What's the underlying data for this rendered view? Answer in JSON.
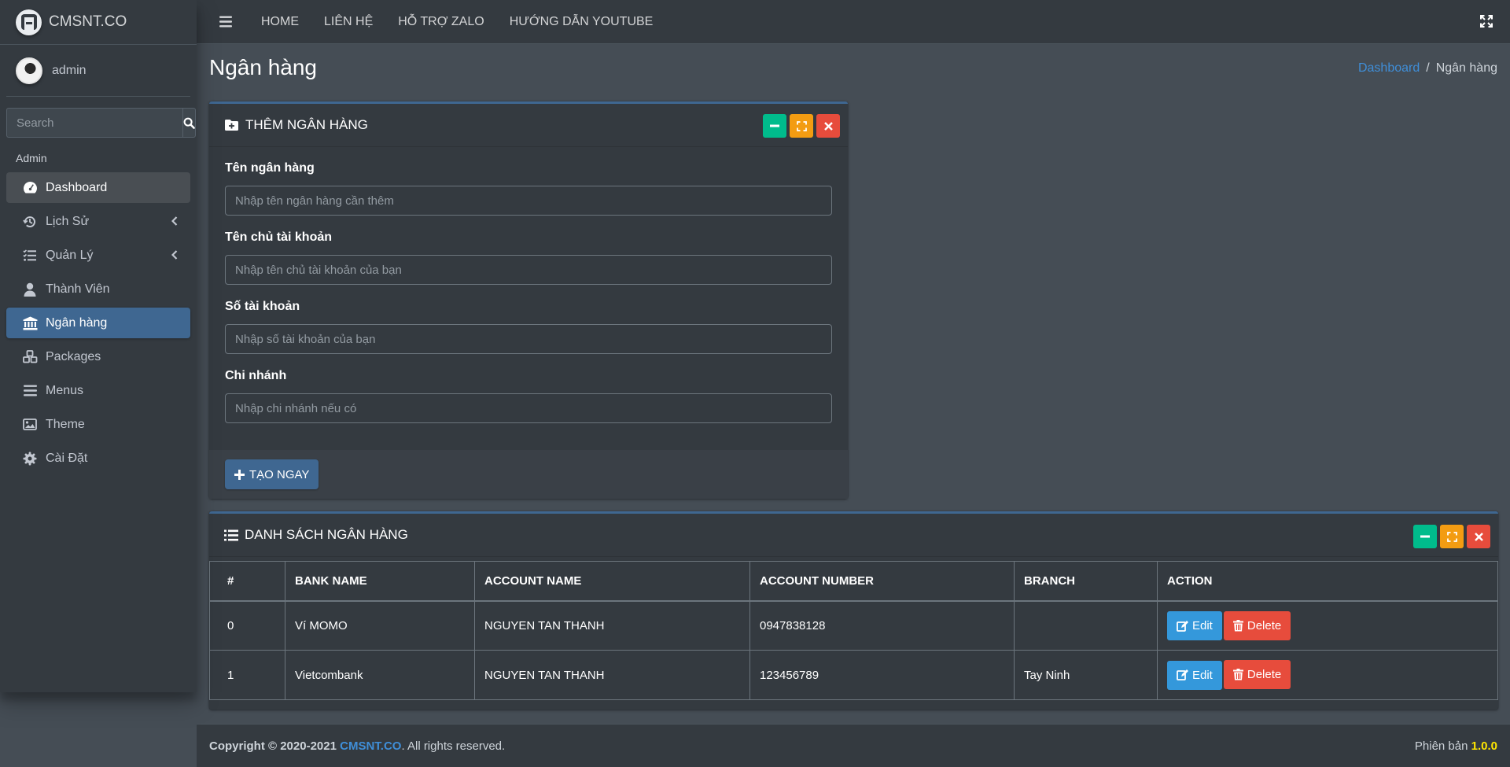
{
  "brand": {
    "name": "CMSNT.CO"
  },
  "user": {
    "name": "admin"
  },
  "search": {
    "placeholder": "Search"
  },
  "sidebar": {
    "header": "Admin",
    "items": [
      {
        "label": "Dashboard",
        "icon": "tachometer-icon"
      },
      {
        "label": "Lịch Sử",
        "icon": "history-icon",
        "has_caret": true
      },
      {
        "label": "Quản Lý",
        "icon": "tasks-icon",
        "has_caret": true
      },
      {
        "label": "Thành Viên",
        "icon": "user-icon"
      },
      {
        "label": "Ngân hàng",
        "icon": "bank-icon"
      },
      {
        "label": "Packages",
        "icon": "cubes-icon"
      },
      {
        "label": "Menus",
        "icon": "bars-icon"
      },
      {
        "label": "Theme",
        "icon": "image-icon"
      },
      {
        "label": "Cài Đặt",
        "icon": "gear-icon"
      }
    ]
  },
  "topnav": {
    "links": [
      "HOME",
      "LIÊN HỆ",
      "HỖ TRỢ ZALO",
      "HƯỚNG DẪN YOUTUBE"
    ]
  },
  "page": {
    "title": "Ngân hàng",
    "breadcrumb": {
      "home": "Dashboard",
      "sep": "/",
      "current": "Ngân hàng"
    }
  },
  "form_card": {
    "title": "THÊM NGÂN HÀNG",
    "fields": [
      {
        "label": "Tên ngân hàng",
        "placeholder": "Nhập tên ngân hàng cần thêm",
        "value": ""
      },
      {
        "label": "Tên chủ tài khoản",
        "placeholder": "Nhập tên chủ tài khoản của bạn",
        "value": ""
      },
      {
        "label": "Số tài khoản",
        "placeholder": "Nhập số tài khoản của bạn",
        "value": ""
      },
      {
        "label": "Chi nhánh",
        "placeholder": "Nhập chi nhánh nếu có",
        "value": ""
      }
    ],
    "submit_label": "TẠO NGAY"
  },
  "list_card": {
    "title": "DANH SÁCH NGÂN HÀNG",
    "columns": [
      "#",
      "BANK NAME",
      "ACCOUNT NAME",
      "ACCOUNT NUMBER",
      "BRANCH",
      "ACTION"
    ],
    "rows": [
      {
        "idx": "0",
        "bank": "Ví MOMO",
        "account_name": "NGUYEN TAN THANH",
        "account_number": "0947838128",
        "branch": ""
      },
      {
        "idx": "1",
        "bank": "Vietcombank",
        "account_name": "NGUYEN TAN THANH",
        "account_number": "123456789",
        "branch": "Tay Ninh"
      }
    ],
    "edit_label": "Edit",
    "delete_label": "Delete"
  },
  "footer": {
    "copyright": "Copyright © 2020-2021",
    "brand": "CMSNT.CO",
    "suffix": ". All rights reserved.",
    "version_label": "Phiên bản",
    "version": "1.0.0"
  },
  "colors": {
    "sidebar_bg": "#343a40",
    "content_bg": "#454d55",
    "active_nav": "#3f6791",
    "tool_green": "#00bc8c",
    "tool_orange": "#f39c12",
    "tool_red": "#e74c3c",
    "edit_btn": "#3498db",
    "delete_btn": "#e74c3c",
    "link": "#3f8ed8",
    "version": "#ffe600"
  }
}
